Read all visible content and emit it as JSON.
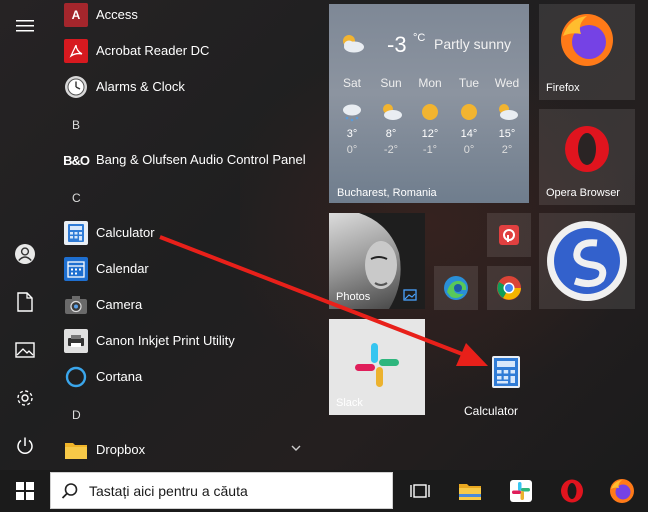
{
  "apps": {
    "items": [
      {
        "label": "Access",
        "icon": "access-icon"
      },
      {
        "label": "Acrobat Reader DC",
        "icon": "acrobat-icon"
      },
      {
        "label": "Alarms & Clock",
        "icon": "clock-icon"
      },
      {
        "label": "Bang & Olufsen Audio Control Panel",
        "icon": "bang-olufsen-icon"
      },
      {
        "label": "Calculator",
        "icon": "calculator-icon"
      },
      {
        "label": "Calendar",
        "icon": "calendar-icon"
      },
      {
        "label": "Camera",
        "icon": "camera-icon"
      },
      {
        "label": "Canon Inkjet Print Utility",
        "icon": "printer-icon"
      },
      {
        "label": "Cortana",
        "icon": "cortana-icon"
      },
      {
        "label": "Dropbox",
        "icon": "folder-icon"
      }
    ],
    "letters": [
      "B",
      "C",
      "D"
    ]
  },
  "weather": {
    "temp": "-3",
    "unit": "°C",
    "description": "Partly sunny",
    "location": "Bucharest, Romania",
    "forecast": [
      {
        "day": "Sat",
        "hi": "3°",
        "lo": "0°"
      },
      {
        "day": "Sun",
        "hi": "8°",
        "lo": "-2°"
      },
      {
        "day": "Mon",
        "hi": "12°",
        "lo": "-1°"
      },
      {
        "day": "Tue",
        "hi": "14°",
        "lo": "0°"
      },
      {
        "day": "Wed",
        "hi": "15°",
        "lo": "2°"
      }
    ]
  },
  "tiles": {
    "firefox": "Firefox",
    "opera": "Opera Browser",
    "photos": "Photos",
    "slack": "Slack",
    "calculator": "Calculator"
  },
  "taskbar": {
    "search_placeholder": "Tastați aici pentru a căuta"
  },
  "colors": {
    "arrow": "#e8201a",
    "taskbar": "#1b1b1b",
    "accent": "#2f7bd6"
  }
}
